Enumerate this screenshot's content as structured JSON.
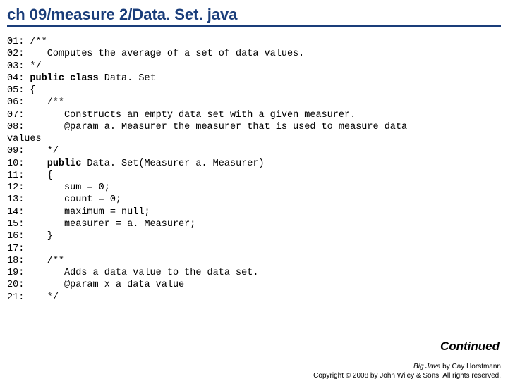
{
  "title": "ch 09/measure 2/Data. Set. java",
  "lines": {
    "l01": "01:",
    "c01": " /**",
    "l02": "02:",
    "c02": "    Computes the average of a set of data values.",
    "l03": "03:",
    "c03": " */",
    "l04": "04:",
    "c04a": " ",
    "c04pub": "public",
    "c04b": " ",
    "c04cls": "class",
    "c04c": " Data. Set",
    "l05": "05:",
    "c05": " {",
    "l06": "06:",
    "c06": "    /**",
    "l07": "07:",
    "c07": "       Constructs an empty data set with a given measurer.",
    "l08": "08:",
    "c08": "       @param a. Measurer the measurer that is used to measure data",
    "valuesTxt": "values",
    "l09": "09:",
    "c09": "    */",
    "l10": "10:",
    "c10a": "    ",
    "c10pub": "public",
    "c10b": " Data. Set(Measurer a. Measurer)",
    "l11": "11:",
    "c11": "    {",
    "l12": "12:",
    "c12": "       sum = 0;",
    "l13": "13:",
    "c13": "       count = 0;",
    "l14": "14:",
    "c14": "       maximum = null;",
    "l15": "15:",
    "c15": "       measurer = a. Measurer;",
    "l16": "16:",
    "c16": "    }",
    "l17": "17:",
    "c17": "",
    "l18": "18:",
    "c18": "    /**",
    "l19": "19:",
    "c19": "       Adds a data value to the data set.",
    "l20": "20:",
    "c20": "       @param x a data value",
    "l21": "21:",
    "c21": "    */"
  },
  "continued": "Continued",
  "footer": {
    "book": "Big Java",
    "author": " by Cay Horstmann",
    "cpr": "Copyright © 2008 by John Wiley & Sons. All rights reserved."
  }
}
